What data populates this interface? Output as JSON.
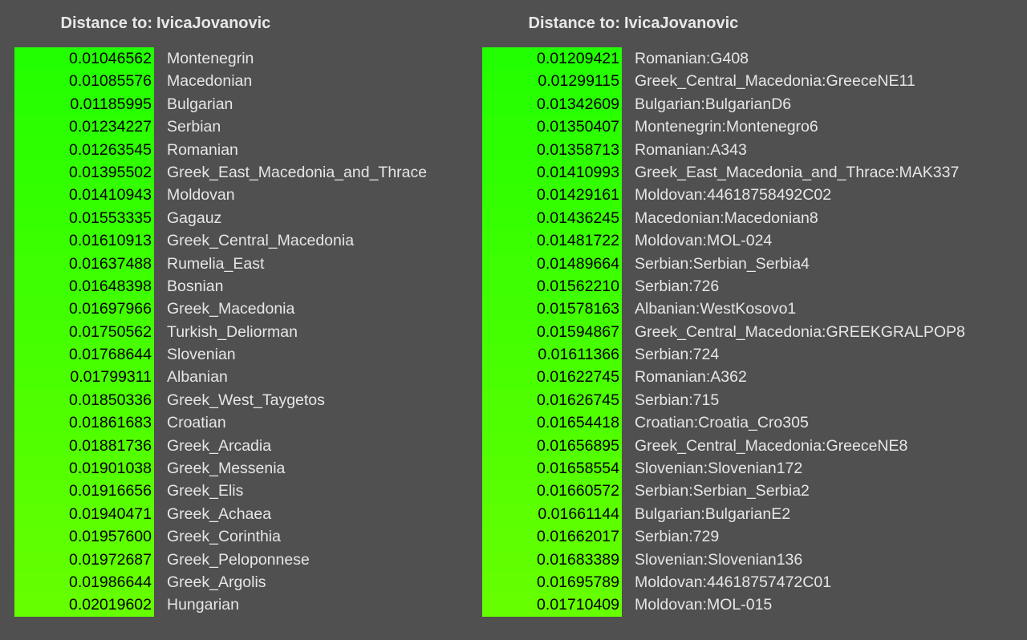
{
  "colors": {
    "background": "#505050",
    "bar_top": "#22ff00",
    "bar_bottom": "#66ff00",
    "name_text": "#e6e6e6",
    "header_text": "#e8e8e8"
  },
  "left": {
    "header_label": "Distance to:",
    "header_name": "IvicaJovanovic",
    "rows": [
      {
        "value": "0.01046562",
        "name": "Montenegrin"
      },
      {
        "value": "0.01085576",
        "name": "Macedonian"
      },
      {
        "value": "0.01185995",
        "name": "Bulgarian"
      },
      {
        "value": "0.01234227",
        "name": "Serbian"
      },
      {
        "value": "0.01263545",
        "name": "Romanian"
      },
      {
        "value": "0.01395502",
        "name": "Greek_East_Macedonia_and_Thrace"
      },
      {
        "value": "0.01410943",
        "name": "Moldovan"
      },
      {
        "value": "0.01553335",
        "name": "Gagauz"
      },
      {
        "value": "0.01610913",
        "name": "Greek_Central_Macedonia"
      },
      {
        "value": "0.01637488",
        "name": "Rumelia_East"
      },
      {
        "value": "0.01648398",
        "name": "Bosnian"
      },
      {
        "value": "0.01697966",
        "name": "Greek_Macedonia"
      },
      {
        "value": "0.01750562",
        "name": "Turkish_Deliorman"
      },
      {
        "value": "0.01768644",
        "name": "Slovenian"
      },
      {
        "value": "0.01799311",
        "name": "Albanian"
      },
      {
        "value": "0.01850336",
        "name": "Greek_West_Taygetos"
      },
      {
        "value": "0.01861683",
        "name": "Croatian"
      },
      {
        "value": "0.01881736",
        "name": "Greek_Arcadia"
      },
      {
        "value": "0.01901038",
        "name": "Greek_Messenia"
      },
      {
        "value": "0.01916656",
        "name": "Greek_Elis"
      },
      {
        "value": "0.01940471",
        "name": "Greek_Achaea"
      },
      {
        "value": "0.01957600",
        "name": "Greek_Corinthia"
      },
      {
        "value": "0.01972687",
        "name": "Greek_Peloponnese"
      },
      {
        "value": "0.01986644",
        "name": "Greek_Argolis"
      },
      {
        "value": "0.02019602",
        "name": "Hungarian"
      }
    ]
  },
  "right": {
    "header_label": "Distance to:",
    "header_name": "IvicaJovanovic",
    "rows": [
      {
        "value": "0.01209421",
        "name": "Romanian:G408"
      },
      {
        "value": "0.01299115",
        "name": "Greek_Central_Macedonia:GreeceNE11"
      },
      {
        "value": "0.01342609",
        "name": "Bulgarian:BulgarianD6"
      },
      {
        "value": "0.01350407",
        "name": "Montenegrin:Montenegro6"
      },
      {
        "value": "0.01358713",
        "name": "Romanian:A343"
      },
      {
        "value": "0.01410993",
        "name": "Greek_East_Macedonia_and_Thrace:MAK337"
      },
      {
        "value": "0.01429161",
        "name": "Moldovan:44618758492C02"
      },
      {
        "value": "0.01436245",
        "name": "Macedonian:Macedonian8"
      },
      {
        "value": "0.01481722",
        "name": "Moldovan:MOL-024"
      },
      {
        "value": "0.01489664",
        "name": "Serbian:Serbian_Serbia4"
      },
      {
        "value": "0.01562210",
        "name": "Serbian:726"
      },
      {
        "value": "0.01578163",
        "name": "Albanian:WestKosovo1"
      },
      {
        "value": "0.01594867",
        "name": "Greek_Central_Macedonia:GREEKGRALPOP8"
      },
      {
        "value": "0.01611366",
        "name": "Serbian:724"
      },
      {
        "value": "0.01622745",
        "name": "Romanian:A362"
      },
      {
        "value": "0.01626745",
        "name": "Serbian:715"
      },
      {
        "value": "0.01654418",
        "name": "Croatian:Croatia_Cro305"
      },
      {
        "value": "0.01656895",
        "name": "Greek_Central_Macedonia:GreeceNE8"
      },
      {
        "value": "0.01658554",
        "name": "Slovenian:Slovenian172"
      },
      {
        "value": "0.01660572",
        "name": "Serbian:Serbian_Serbia2"
      },
      {
        "value": "0.01661144",
        "name": "Bulgarian:BulgarianE2"
      },
      {
        "value": "0.01662017",
        "name": "Serbian:729"
      },
      {
        "value": "0.01683389",
        "name": "Slovenian:Slovenian136"
      },
      {
        "value": "0.01695789",
        "name": "Moldovan:44618757472C01"
      },
      {
        "value": "0.01710409",
        "name": "Moldovan:MOL-015"
      }
    ]
  }
}
